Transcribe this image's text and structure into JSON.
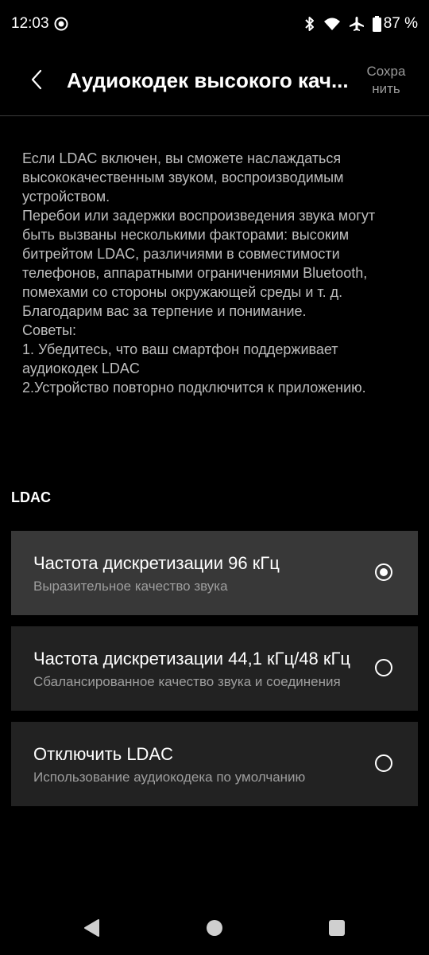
{
  "status_bar": {
    "time": "12:03",
    "battery": "87 %",
    "icons": [
      "screen-record-icon",
      "bluetooth-icon",
      "wifi-icon",
      "airplane-icon",
      "battery-icon"
    ]
  },
  "header": {
    "title": "Аудиокодек высокого кач...",
    "save_label": "Сохранить",
    "back_icon": "chevron-left-icon"
  },
  "description": {
    "lines": [
      "Если LDAC включен, вы сможете наслаждаться высококачественным звуком, воспроизводимым устройством.",
      "Перебои или задержки воспроизведения звука могут быть вызваны несколькими факторами: высоким битрейтом LDAC, различиями в совместимости телефонов, аппаратными ограничениями Bluetooth, помехами со стороны окружающей среды и т. д. Благодарим вас за терпение и понимание.",
      "Советы:",
      "1. Убедитесь, что ваш смартфон поддерживает аудиокодек LDAC",
      "2.Устройство повторно подключится к приложению."
    ]
  },
  "section": {
    "title": "LDAC"
  },
  "options": [
    {
      "title": "Частота дискретизации 96 кГц",
      "subtitle": "Выразительное качество звука",
      "selected": true
    },
    {
      "title": "Частота дискретизации 44,1 кГц/48 кГц",
      "subtitle": "Сбалансированное качество звука и соединения",
      "selected": false
    },
    {
      "title": "Отключить LDAC",
      "subtitle": "Использование аудиокодека по умолчанию",
      "selected": false
    }
  ],
  "nav_bar": {
    "icons": [
      "back-triangle-icon",
      "home-circle-icon",
      "recents-square-icon"
    ]
  },
  "colors": {
    "background": "#000000",
    "card": "#222222",
    "card_selected": "#383838",
    "text_secondary": "#9e9e9e"
  }
}
